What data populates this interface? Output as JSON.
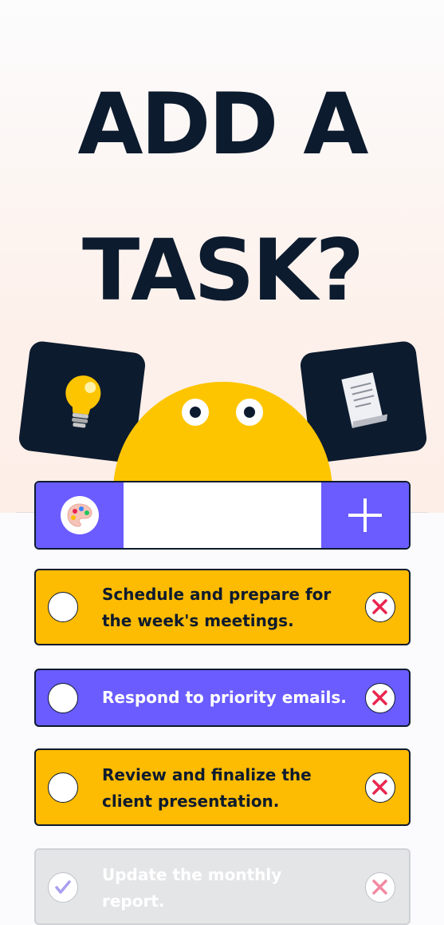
{
  "hero": {
    "title_line1": "ADD A",
    "title_line2": "TASK?",
    "left_card_icon": "lightbulb-icon",
    "right_card_icon": "scroll-icon"
  },
  "input_bar": {
    "palette_icon": "palette-icon",
    "placeholder": "",
    "value": "",
    "add_icon": "plus-icon"
  },
  "colors": {
    "navy": "#0d1b2e",
    "yellow": "#fdbb02",
    "purple": "#6a5cff",
    "done_gray": "#e4e5e7",
    "delete_red": "#e8264f"
  },
  "tasks": [
    {
      "text": "Schedule and prepare for the week's meetings.",
      "color": "yellow",
      "done": false
    },
    {
      "text": "Respond to priority emails.",
      "color": "purple",
      "done": false
    },
    {
      "text": "Review and finalize the client presentation.",
      "color": "yellow",
      "done": false
    },
    {
      "text": "Update the monthly report.",
      "color": "gray",
      "done": true
    }
  ]
}
